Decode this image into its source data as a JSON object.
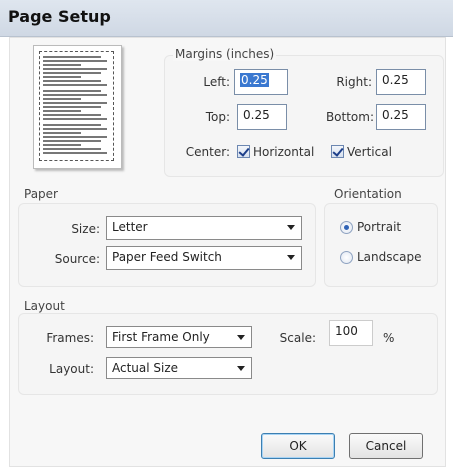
{
  "dialog": {
    "title": "Page Setup"
  },
  "margins": {
    "group_label": "Margins (inches)",
    "left_label": "Left:",
    "left_value": "0.25",
    "right_label": "Right:",
    "right_value": "0.25",
    "top_label": "Top:",
    "top_value": "0.25",
    "bottom_label": "Bottom:",
    "bottom_value": "0.25",
    "center_label": "Center:",
    "horizontal_label": "Horizontal",
    "horizontal_checked": true,
    "vertical_label": "Vertical",
    "vertical_checked": true
  },
  "paper": {
    "group_label": "Paper",
    "size_label": "Size:",
    "size_value": "Letter",
    "source_label": "Source:",
    "source_value": "Paper Feed Switch"
  },
  "orientation": {
    "group_label": "Orientation",
    "portrait_label": "Portrait",
    "portrait_selected": true,
    "landscape_label": "Landscape",
    "landscape_selected": false
  },
  "layout": {
    "group_label": "Layout",
    "frames_label": "Frames:",
    "frames_value": "First Frame Only",
    "layout_label": "Layout:",
    "layout_value": "Actual Size",
    "scale_label": "Scale:",
    "scale_value": "100",
    "scale_unit": "%"
  },
  "buttons": {
    "ok": "OK",
    "cancel": "Cancel"
  },
  "colors": {
    "selection": "#3a78d0",
    "title_bar": "#dfe6ef"
  }
}
